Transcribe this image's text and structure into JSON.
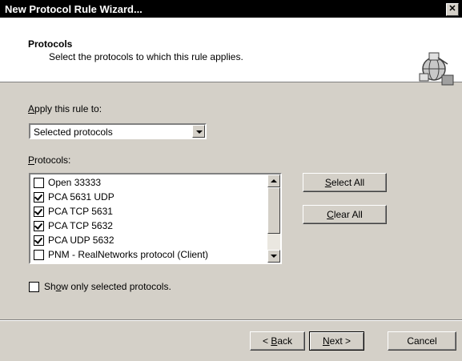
{
  "window": {
    "title": "New Protocol Rule Wizard...",
    "close_glyph": "✕"
  },
  "header": {
    "title": "Protocols",
    "subtitle": "Select the protocols to which this rule applies.",
    "icon": "network-globe-icon"
  },
  "apply": {
    "label_prefix": "A",
    "label_rest": "pply this rule to:",
    "selected": "Selected protocols"
  },
  "protocols": {
    "label_prefix": "P",
    "label_rest": "rotocols:",
    "items": [
      {
        "label": "Open 33333",
        "checked": false
      },
      {
        "label": "PCA 5631 UDP",
        "checked": true
      },
      {
        "label": "PCA TCP 5631",
        "checked": true
      },
      {
        "label": "PCA TCP 5632",
        "checked": true
      },
      {
        "label": "PCA UDP 5632",
        "checked": true
      },
      {
        "label": "PNM - RealNetworks protocol (Client)",
        "checked": false
      }
    ]
  },
  "buttons": {
    "select_all_prefix": "S",
    "select_all_rest": "elect All",
    "clear_all_prefix": "C",
    "clear_all_rest": "lear All",
    "back_lead": "< ",
    "back_prefix": "B",
    "back_rest": "ack",
    "next_prefix": "N",
    "next_rest": "ext >",
    "cancel": "Cancel"
  },
  "show_only": {
    "label_before": "Sh",
    "label_accel": "o",
    "label_after": "w only selected protocols.",
    "checked": false
  }
}
